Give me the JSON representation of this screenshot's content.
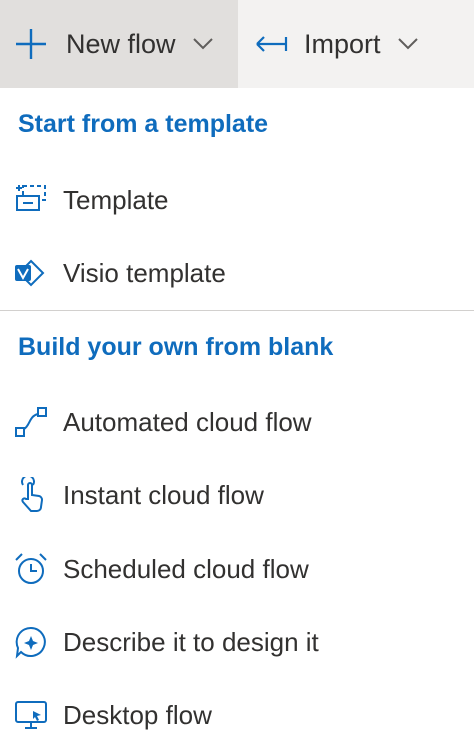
{
  "toolbar": {
    "new_flow_label": "New flow",
    "import_label": "Import"
  },
  "menu": {
    "sections": [
      {
        "header": "Start from a template",
        "items": [
          {
            "label": "Template",
            "icon": "template-icon"
          },
          {
            "label": "Visio template",
            "icon": "visio-icon"
          }
        ]
      },
      {
        "header": "Build your own from blank",
        "items": [
          {
            "label": "Automated cloud flow",
            "icon": "automated-flow-icon"
          },
          {
            "label": "Instant cloud flow",
            "icon": "touch-hand-icon"
          },
          {
            "label": "Scheduled cloud flow",
            "icon": "alarm-clock-icon"
          },
          {
            "label": "Describe it to design it",
            "icon": "chat-sparkle-icon"
          },
          {
            "label": "Desktop flow",
            "icon": "desktop-flow-icon"
          }
        ]
      }
    ]
  },
  "colors": {
    "accent": "#0f6cbd",
    "toolbar_bg": "#f3f2f1",
    "toolbar_active_bg": "#e1dfdd",
    "text": "#323130"
  }
}
